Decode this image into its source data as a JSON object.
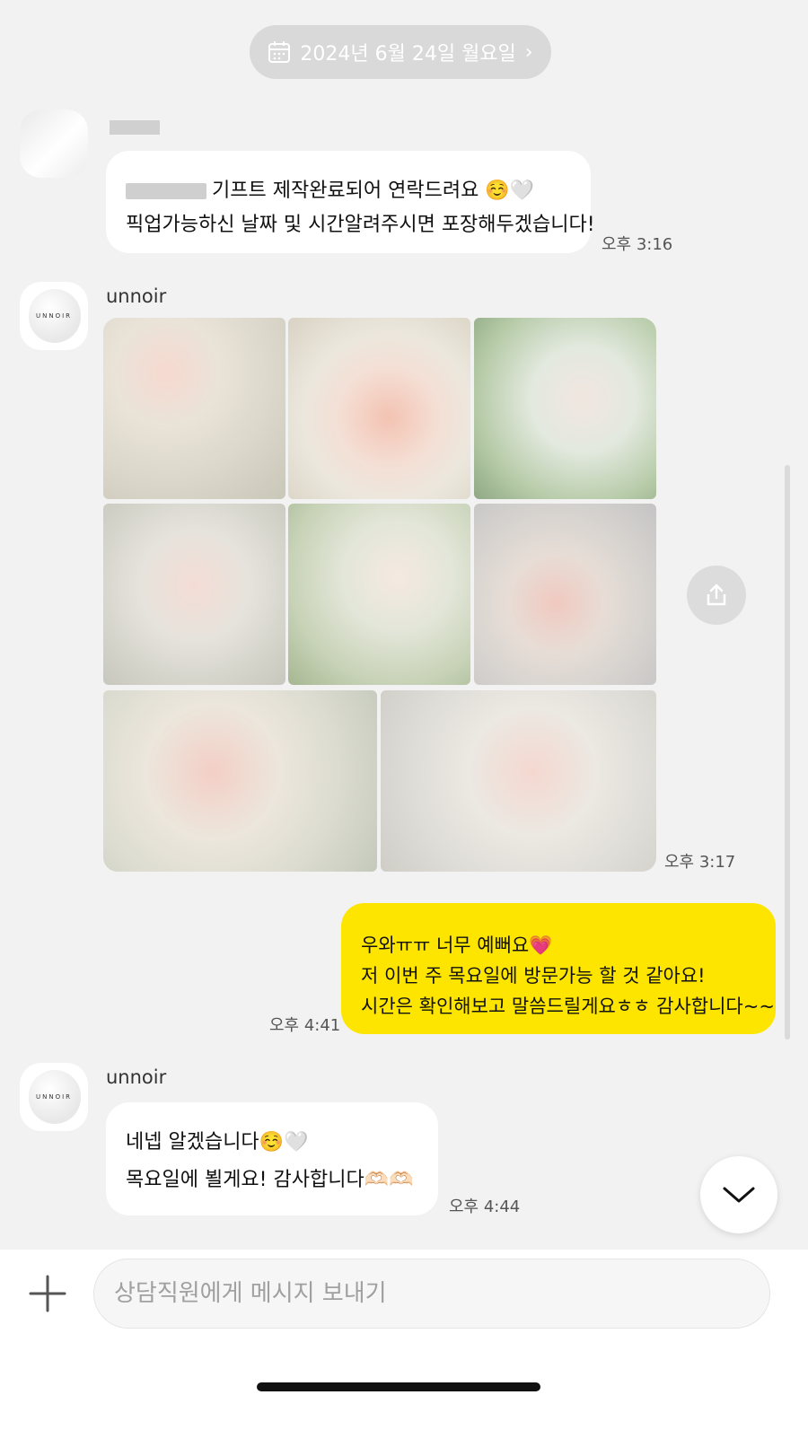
{
  "date_divider": {
    "label": "2024년 6월 24일 월요일",
    "chevron": "›",
    "icon": "calendar-icon"
  },
  "messages": [
    {
      "id": "m1",
      "sender": "",
      "lines": [
        "기프트 제작완료되어 연락드려요 ☺️🤍",
        "픽업가능하신 날짜 및 시간알려주시면 포장해두겠습니다!"
      ],
      "time": "오후 3:16"
    },
    {
      "id": "m2",
      "sender": "unnoir",
      "avatar_logo": "UNNOIR",
      "photo_count": 8,
      "time": "오후 3:17"
    },
    {
      "id": "m3",
      "sender": "me",
      "lines": [
        "우와ㅠㅠ 너무 예뻐요💗",
        "저 이번 주 목요일에 방문가능 할 것 같아요!",
        "시간은 확인해보고 말씀드릴게요ㅎㅎ 감사합니다~~"
      ],
      "time": "오후 4:41"
    },
    {
      "id": "m4",
      "sender": "unnoir",
      "avatar_logo": "UNNOIR",
      "lines": [
        "네넵 알겠습니다☺️🤍",
        "목요일에 뵐게요! 감사합니다🫶🏻🫶🏻"
      ],
      "time": "오후 4:44"
    }
  ],
  "composer": {
    "placeholder": "상담직원에게 메시지 보내기",
    "plus_icon": "plus-icon"
  },
  "buttons": {
    "share_icon": "share-icon",
    "scroll_down_icon": "chevron-down-icon"
  },
  "colors": {
    "background": "#f2f2f2",
    "my_bubble": "#fee500",
    "their_bubble": "#ffffff",
    "date_pill": "#d9d9d9"
  }
}
